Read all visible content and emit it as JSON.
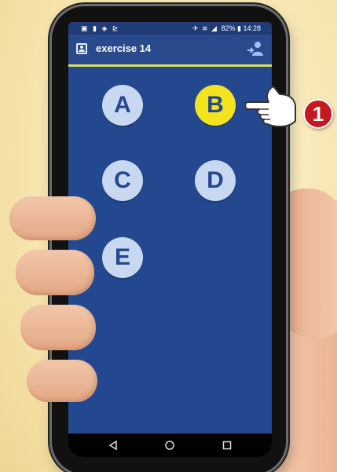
{
  "status_bar": {
    "left_icons": "▣ ▮ ◈ ⊵",
    "right_icons": "✈ ≋ ◢",
    "battery": "82%",
    "time": "14:28"
  },
  "app_bar": {
    "title": "exercise 14",
    "profile_icon": "profile-card-icon",
    "switch_icon": "user-switch-icon"
  },
  "answers": [
    {
      "label": "A",
      "selected": false
    },
    {
      "label": "B",
      "selected": true
    },
    {
      "label": "C",
      "selected": false
    },
    {
      "label": "D",
      "selected": false
    },
    {
      "label": "E",
      "selected": false
    }
  ],
  "callout": {
    "number": "1"
  },
  "nav": {
    "back_icon": "◁",
    "home_icon": "○",
    "recent_icon": "□"
  },
  "colors": {
    "screen_bg": "#24488f",
    "answer_bg": "#c9d8f1",
    "selected_bg": "#f3e31e",
    "accent_line": "#dfe25b",
    "callout_red": "#c41a1f"
  }
}
